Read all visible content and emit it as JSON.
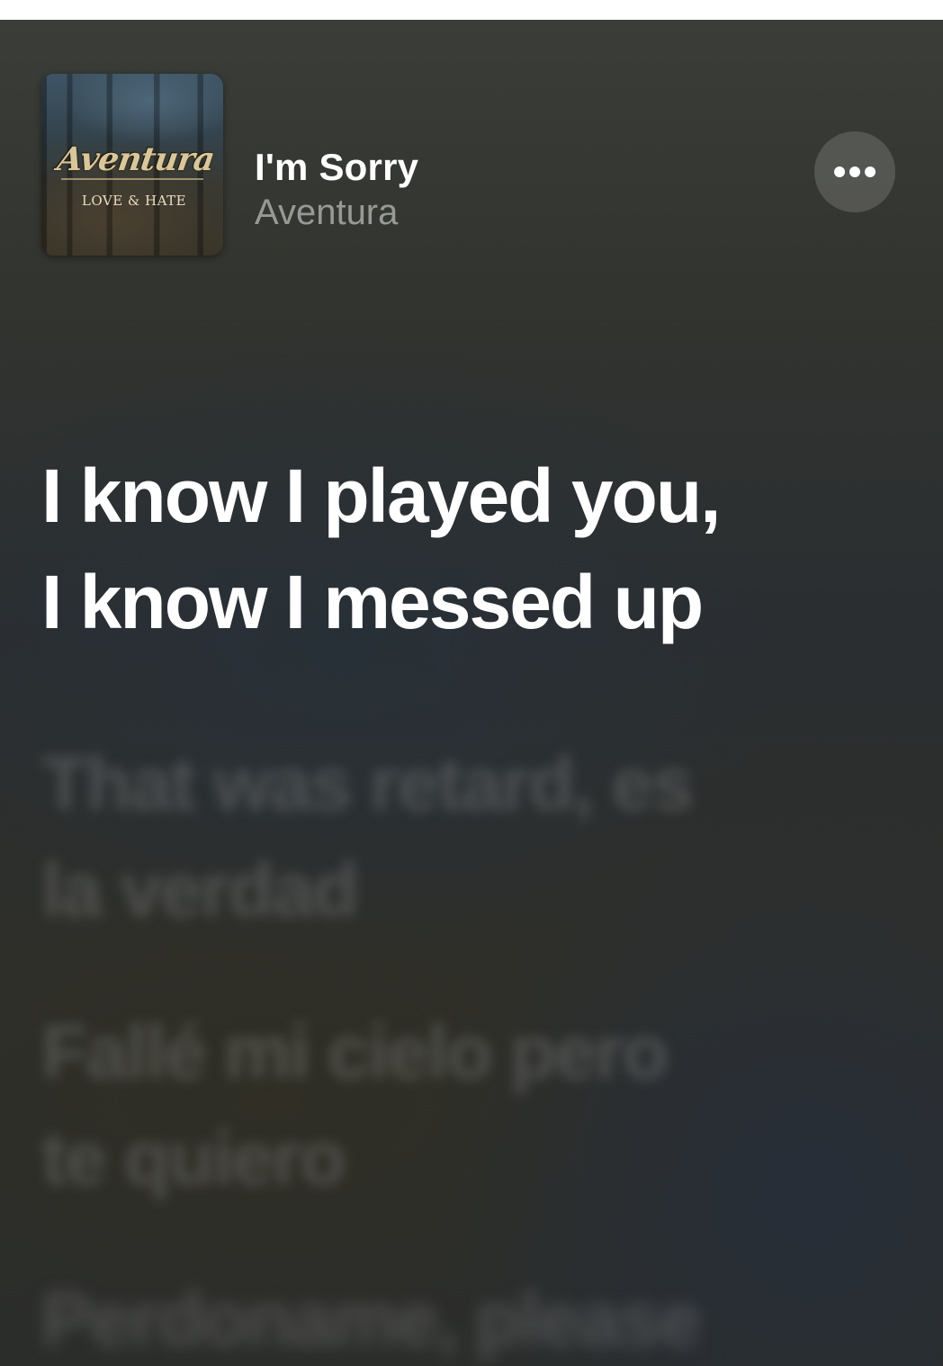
{
  "now_playing": {
    "title": "I'm Sorry",
    "artist": "Aventura",
    "artwork": {
      "logo_text": "Aventura",
      "subtitle_text": "LOVE & HATE"
    },
    "more_icon": "ellipsis-icon"
  },
  "lyrics": {
    "active": {
      "line1": "I know I played you,",
      "line2": "I know I messed up"
    },
    "upcoming": [
      {
        "line1": "That was retard, es",
        "line2": "la verdad"
      },
      {
        "line1": "Fallé mi cielo pero",
        "line2": "te quiero"
      },
      {
        "line1": "Perdoname, please",
        "line2": ""
      }
    ]
  },
  "colors": {
    "background": "#2e302d",
    "active_lyric": "#ffffff",
    "dim_lyric": "#969694",
    "artist_text": "#8c8c8a"
  }
}
